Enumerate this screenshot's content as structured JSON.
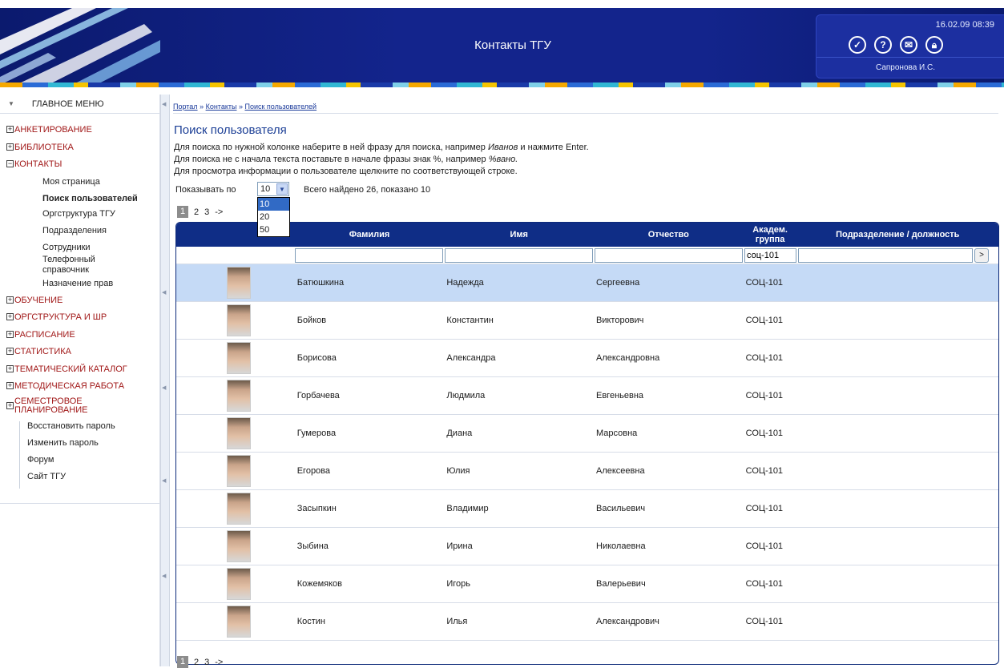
{
  "header": {
    "title": "Контакты ТГУ",
    "datetime": "16.02.09 08:39",
    "user": "Сапронова И.С.",
    "icons": [
      "check-icon",
      "help-icon",
      "mail-icon",
      "lock-icon"
    ]
  },
  "sidebar": {
    "menu_title": "ГЛАВНОЕ МЕНЮ",
    "sections": [
      {
        "label": "АНКЕТИРОВАНИЕ",
        "toggle": "+"
      },
      {
        "label": "БИБЛИОТЕКА",
        "toggle": "+"
      },
      {
        "label": "КОНТАКТЫ",
        "toggle": "−"
      }
    ],
    "contacts_items": [
      "Моя страница",
      "Поиск пользователей",
      "Оргструктура ТГУ",
      "Подразделения",
      "Сотрудники",
      "Телефонный справочник",
      "Назначение прав"
    ],
    "sections2": [
      {
        "label": "ОБУЧЕНИЕ",
        "toggle": "+"
      },
      {
        "label": "ОРГСТРУКТУРА И ШР",
        "toggle": "+"
      },
      {
        "label": "РАСПИСАНИЕ",
        "toggle": "+"
      },
      {
        "label": "СТАТИСТИКА",
        "toggle": "+"
      },
      {
        "label": "ТЕМАТИЧЕСКИЙ КАТАЛОГ",
        "toggle": "+"
      },
      {
        "label": "МЕТОДИЧЕСКАЯ РАБОТА",
        "toggle": "+"
      },
      {
        "label": "СЕМЕСТРОВОЕ ПЛАНИРОВАНИЕ",
        "toggle": "+"
      }
    ],
    "links": [
      "Восстановить пароль",
      "Изменить пароль",
      "Форум",
      "Сайт ТГУ"
    ]
  },
  "breadcrumb": {
    "items": [
      "Портал",
      "Контакты",
      "Поиск пользователей"
    ],
    "sep": " » "
  },
  "page": {
    "title": "Поиск пользователя",
    "desc1_a": "Для поиска по нужной колонке наберите в ней фразу для поиска, например ",
    "desc1_i": "Иванов",
    "desc1_b": " и нажмите Enter.",
    "desc2_a": "Для поиска не с начала текста поставьте в начале фразы знак %, например ",
    "desc2_i": "%вано.",
    "desc3": "Для просмотра информации о пользователе щелкните по соответствующей строке.",
    "show_by_label": "Показывать по",
    "page_size": "10",
    "page_size_options": [
      "10",
      "20",
      "50"
    ],
    "found_text": "Всего найдено 26, показано 10",
    "pages": [
      "1",
      "2",
      "3",
      "->"
    ]
  },
  "grid": {
    "columns": [
      "",
      "Фамилия",
      "Имя",
      "Отчество",
      "Академ. группа",
      "Подразделение / должность"
    ],
    "filter_group": "соц-101",
    "go_label": ">",
    "rows": [
      [
        "Батюшкина",
        "Надежда",
        "Сергеевна",
        "СОЦ-101"
      ],
      [
        "Бойков",
        "Константин",
        "Викторович",
        "СОЦ-101"
      ],
      [
        "Борисова",
        "Александра",
        "Александровна",
        "СОЦ-101"
      ],
      [
        "Горбачева",
        "Людмила",
        "Евгеньевна",
        "СОЦ-101"
      ],
      [
        "Гумерова",
        "Диана",
        "Марсовна",
        "СОЦ-101"
      ],
      [
        "Егорова",
        "Юлия",
        "Алексеевна",
        "СОЦ-101"
      ],
      [
        "Засыпкин",
        "Владимир",
        "Васильевич",
        "СОЦ-101"
      ],
      [
        "Зыбина",
        "Ирина",
        "Николаевна",
        "СОЦ-101"
      ],
      [
        "Кожемяков",
        "Игорь",
        "Валерьевич",
        "СОЦ-101"
      ],
      [
        "Костин",
        "Илья",
        "Александрович",
        "СОЦ-101"
      ]
    ]
  },
  "colors": {
    "header_bg": "#13248c",
    "grid_header": "#0f2d86",
    "menu_red": "#a11818",
    "selected_row": "#c5daf6"
  }
}
